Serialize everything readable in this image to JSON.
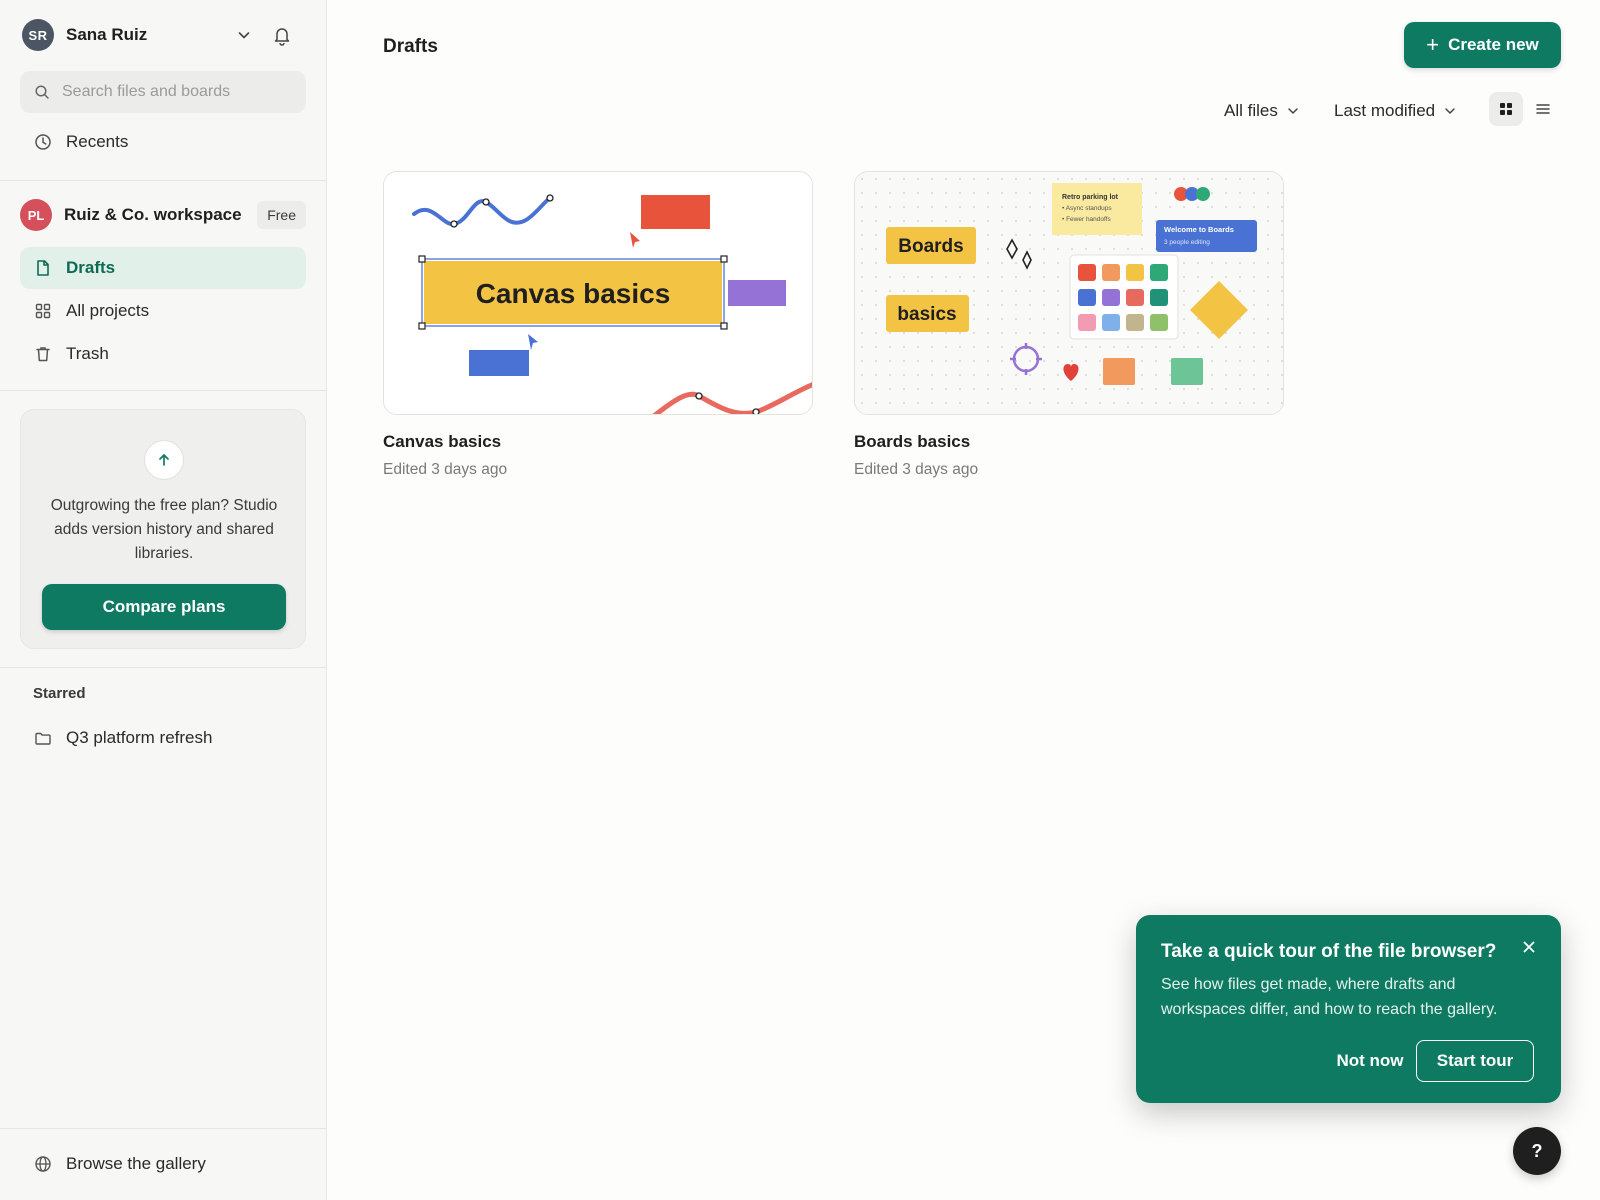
{
  "user": {
    "initials": "SR",
    "name": "Sana Ruiz"
  },
  "search": {
    "placeholder": "Search files and boards"
  },
  "nav": {
    "recents": "Recents",
    "drafts": "Drafts",
    "all_projects": "All projects",
    "trash": "Trash",
    "browse_gallery": "Browse the gallery"
  },
  "workspace": {
    "initials": "PL",
    "name": "Ruiz & Co. workspace",
    "plan": "Free"
  },
  "promo": {
    "text": "Outgrowing the free plan? Studio adds version history and shared libraries.",
    "button": "Compare plans"
  },
  "starred": {
    "label": "Starred",
    "items": [
      {
        "label": "Q3 platform refresh"
      }
    ]
  },
  "main": {
    "title": "Drafts",
    "create_button": "Create new",
    "filter_files": "All files",
    "sort": "Last modified"
  },
  "files": [
    {
      "name": "Canvas basics",
      "edited": "Edited 3 days ago",
      "thumb_text": "Canvas basics"
    },
    {
      "name": "Boards basics",
      "edited": "Edited 3 days ago",
      "thumb_label_1": "Boards",
      "thumb_label_2": "basics",
      "sticky_title": "Retro parking lot",
      "sticky_line_1": "• Async standups",
      "sticky_line_2": "• Fewer handoffs",
      "callout_title": "Welcome to Boards",
      "callout_sub": "3 people editing"
    }
  ],
  "tour": {
    "title": "Take a quick tour of the file browser?",
    "body": "See how files get made, where drafts and workspaces differ, and how to reach the gallery.",
    "not_now": "Not now",
    "start": "Start tour"
  },
  "help": {
    "label": "?"
  },
  "colors": {
    "accent": "#0f7a62",
    "active_nav_bg": "#e2f0ea",
    "active_nav_text": "#0d6b55"
  }
}
